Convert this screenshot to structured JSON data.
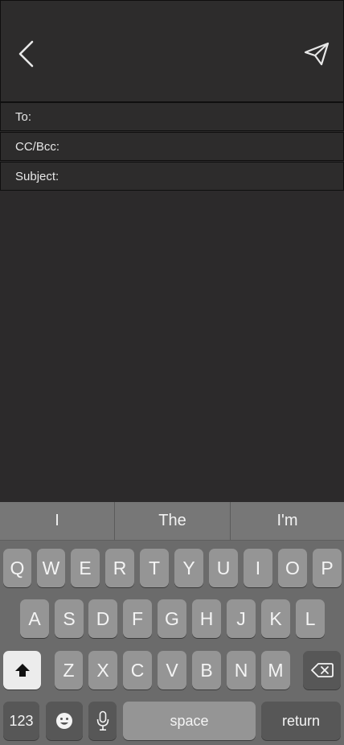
{
  "compose": {
    "to_label": "To:",
    "cc_label": "CC/Bcc:",
    "subject_label": "Subject:",
    "to_value": "",
    "cc_value": "",
    "subject_value": ""
  },
  "icons": {
    "back": "chevron-left-icon",
    "send": "paper-plane-icon",
    "shift": "shift-arrow-icon",
    "delete": "backspace-icon",
    "emoji": "smiley-face-icon",
    "mic": "microphone-icon"
  },
  "keyboard": {
    "predictions": [
      "I",
      "The",
      "I'm"
    ],
    "row1": [
      "Q",
      "W",
      "E",
      "R",
      "T",
      "Y",
      "U",
      "I",
      "O",
      "P"
    ],
    "row2": [
      "A",
      "S",
      "D",
      "F",
      "G",
      "H",
      "J",
      "K",
      "L"
    ],
    "row3": [
      "Z",
      "X",
      "C",
      "V",
      "B",
      "N",
      "M"
    ],
    "numbers_label": "123",
    "space_label": "space",
    "return_label": "return"
  },
  "colors": {
    "background": "#2c2a2b",
    "keyboard_bg": "#6b6b6b",
    "key_light": "#959595",
    "key_dark": "#575757",
    "shift_key": "#ececec"
  }
}
